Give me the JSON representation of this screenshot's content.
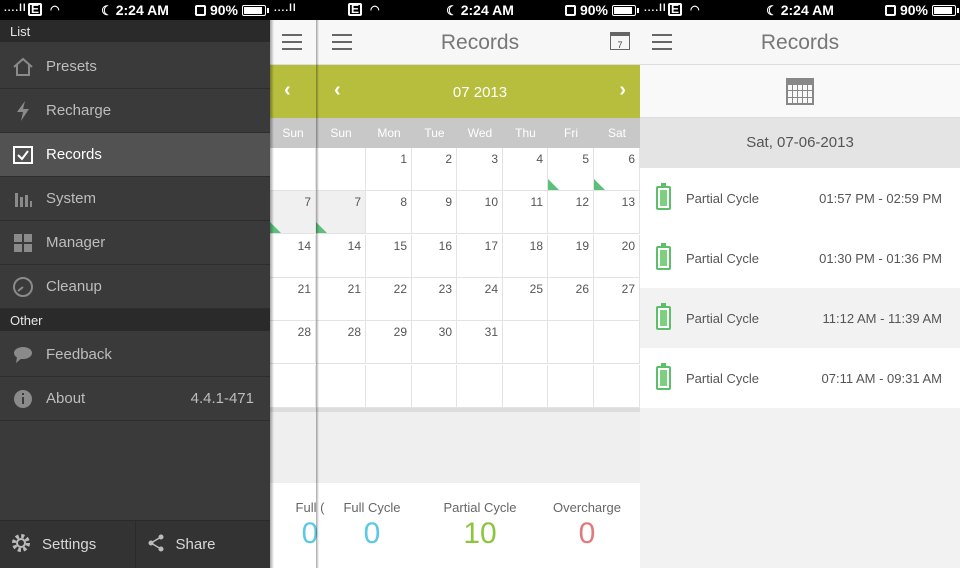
{
  "status": {
    "signal": "....ll",
    "carrier_icon": "E",
    "time": "2:24 AM",
    "battery": "90%"
  },
  "drawer": {
    "section_list": "List",
    "items": [
      {
        "label": "Presets",
        "icon": "home-icon"
      },
      {
        "label": "Recharge",
        "icon": "lightning-icon"
      },
      {
        "label": "Records",
        "icon": "checkbox-icon",
        "selected": true
      },
      {
        "label": "System",
        "icon": "bar-chart-icon"
      },
      {
        "label": "Manager",
        "icon": "grid-icon"
      },
      {
        "label": "Cleanup",
        "icon": "gauge-icon"
      }
    ],
    "section_other": "Other",
    "other_items": [
      {
        "label": "Feedback",
        "icon": "chat-icon"
      },
      {
        "label": "About",
        "icon": "info-icon",
        "value": "4.4.1-471"
      }
    ],
    "settings_label": "Settings",
    "share_label": "Share"
  },
  "calendar": {
    "title": "Records",
    "calendar_icon_day": "7",
    "month": "07 2013",
    "weekdays": [
      "Sun",
      "Mon",
      "Tue",
      "Wed",
      "Thu",
      "Fri",
      "Sat"
    ],
    "weeks": [
      [
        "",
        "1",
        "2",
        "3",
        "4",
        "5",
        "6"
      ],
      [
        "7",
        "8",
        "9",
        "10",
        "11",
        "12",
        "13"
      ],
      [
        "14",
        "15",
        "16",
        "17",
        "18",
        "19",
        "20"
      ],
      [
        "21",
        "22",
        "23",
        "24",
        "25",
        "26",
        "27"
      ],
      [
        "28",
        "29",
        "30",
        "31",
        "",
        "",
        ""
      ],
      [
        "",
        "",
        "",
        "",
        "",
        "",
        ""
      ]
    ],
    "marked_days": [
      "5",
      "6",
      "7"
    ],
    "behind_partial": {
      "weekday": "Sun",
      "days": [
        "7",
        "14",
        "21",
        "28"
      ],
      "summary_label": "Full (",
      "summary_value": "0"
    },
    "summary": [
      {
        "label": "Full Cycle",
        "value": "0",
        "color": "#5bc8e4"
      },
      {
        "label": "Partial Cycle",
        "value": "10",
        "color": "#8cc63f"
      },
      {
        "label": "Overcharge",
        "value": "0",
        "color": "#e27a7a"
      }
    ]
  },
  "records": {
    "title": "Records",
    "date": "Sat, 07-06-2013",
    "items": [
      {
        "type": "Partial Cycle",
        "time": "01:57 PM - 02:59 PM"
      },
      {
        "type": "Partial Cycle",
        "time": "01:30 PM - 01:36 PM"
      },
      {
        "type": "Partial Cycle",
        "time": "11:12 AM - 11:39 AM"
      },
      {
        "type": "Partial Cycle",
        "time": "07:11 AM - 09:31 AM"
      }
    ]
  }
}
